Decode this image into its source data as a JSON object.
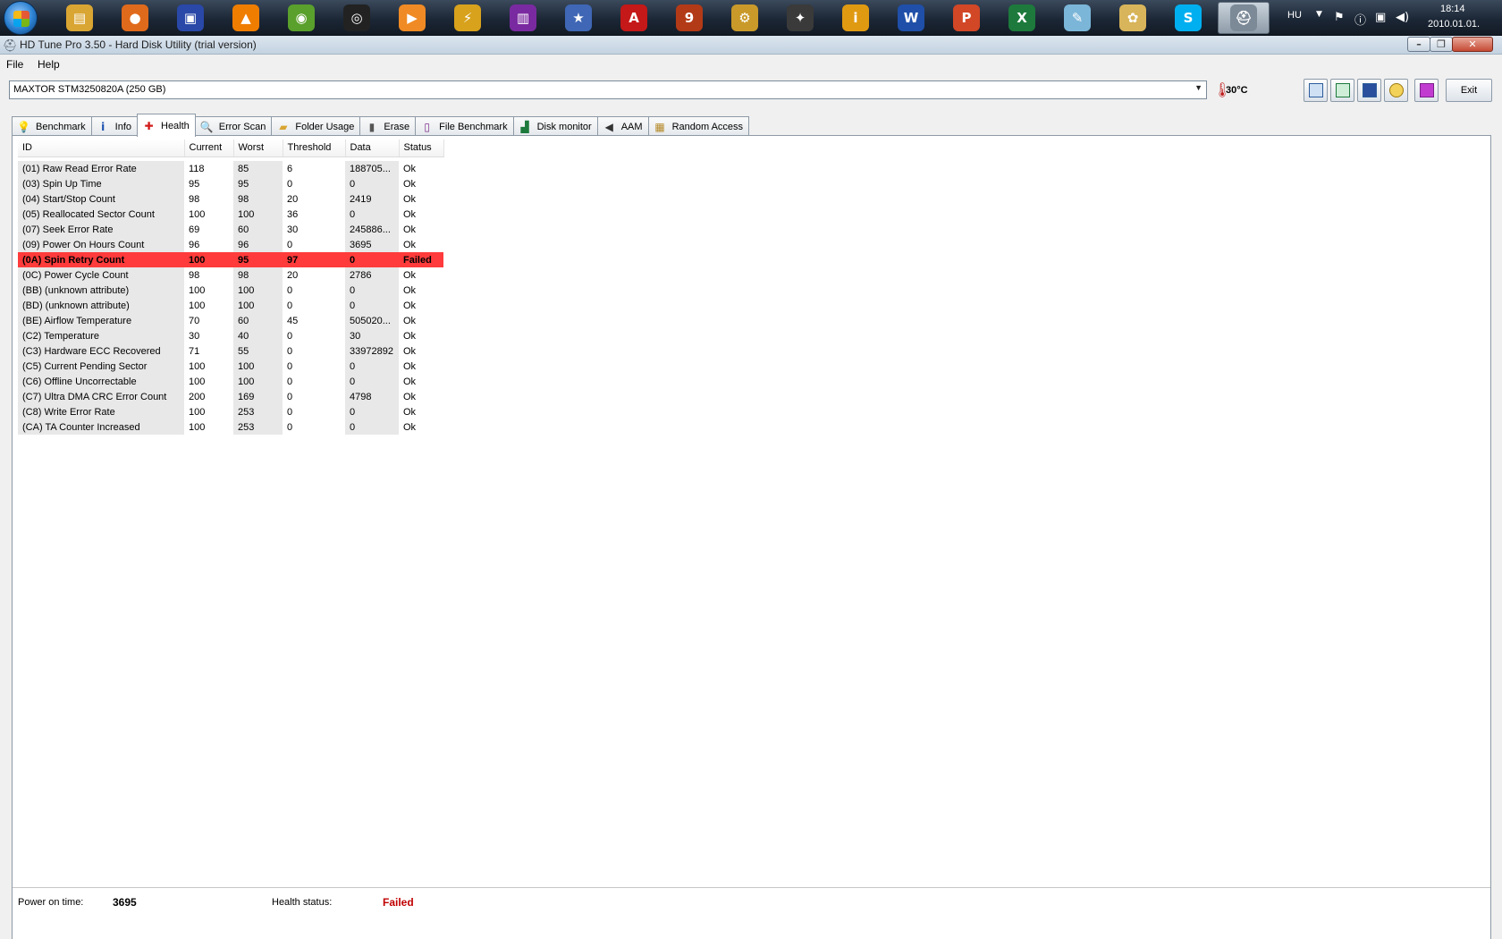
{
  "taskbar": {
    "apps": [
      {
        "name": "windows-explorer-icon",
        "glyph": "▤",
        "color": "#d9a533"
      },
      {
        "name": "firefox-icon",
        "glyph": "●",
        "color": "#e06a1b"
      },
      {
        "name": "save-floppy-icon",
        "glyph": "▣",
        "color": "#2948a8"
      },
      {
        "name": "vlc-icon",
        "glyph": "▲",
        "color": "#ef7d00"
      },
      {
        "name": "windows-media-icon",
        "glyph": "◉",
        "color": "#5aa02c"
      },
      {
        "name": "eye-app-icon",
        "glyph": "◎",
        "color": "#222222"
      },
      {
        "name": "media-player-icon",
        "glyph": "▶",
        "color": "#f08a24"
      },
      {
        "name": "winamp-icon",
        "glyph": "⚡",
        "color": "#d8a21c"
      },
      {
        "name": "winrar-icon",
        "glyph": "▥",
        "color": "#7a2aa0"
      },
      {
        "name": "shield-app-icon",
        "glyph": "★",
        "color": "#3f67b5"
      },
      {
        "name": "adobe-reader-icon",
        "glyph": "A",
        "color": "#c51818"
      },
      {
        "name": "nero-icon",
        "glyph": "9",
        "color": "#b33a17"
      },
      {
        "name": "gear-app-icon",
        "glyph": "⚙",
        "color": "#c99a2a"
      },
      {
        "name": "settings-app-icon",
        "glyph": "✦",
        "color": "#3a3a3a"
      },
      {
        "name": "info-app-icon",
        "glyph": "i",
        "color": "#e09a12"
      },
      {
        "name": "word-icon",
        "glyph": "W",
        "color": "#1f4fa8"
      },
      {
        "name": "powerpoint-icon",
        "glyph": "P",
        "color": "#d24726"
      },
      {
        "name": "excel-icon",
        "glyph": "X",
        "color": "#1d7a3c"
      },
      {
        "name": "notepad-icon",
        "glyph": "✎",
        "color": "#7bb6d8"
      },
      {
        "name": "paint-icon",
        "glyph": "✿",
        "color": "#d8b45a"
      },
      {
        "name": "skype-icon",
        "glyph": "S",
        "color": "#00aff0"
      },
      {
        "name": "hd-tune-icon",
        "glyph": "⛑",
        "color": "#7c8a98"
      }
    ],
    "language": "HU",
    "time": "18:14",
    "date": "2010.01.01."
  },
  "window": {
    "title": "HD Tune Pro 3.50 - Hard Disk Utility (trial version)"
  },
  "menu": {
    "file": "File",
    "help": "Help"
  },
  "toolbar": {
    "drive": "MAXTOR STM3250820A (250 GB)",
    "temperature": "30°C",
    "exit": "Exit"
  },
  "tabs": [
    {
      "label": "Benchmark",
      "icon": "benchmark-icon",
      "glyph": "💡",
      "color": "#c8a400"
    },
    {
      "label": "Info",
      "icon": "info-icon",
      "glyph": "i",
      "color": "#1a4fb0"
    },
    {
      "label": "Health",
      "icon": "health-cross-icon",
      "glyph": "✚",
      "color": "#d21a1a"
    },
    {
      "label": "Error Scan",
      "icon": "magnifier-icon",
      "glyph": "🔍",
      "color": "#2a5da8"
    },
    {
      "label": "Folder Usage",
      "icon": "folder-icon",
      "glyph": "▰",
      "color": "#d9a533"
    },
    {
      "label": "Erase",
      "icon": "trash-icon",
      "glyph": "▮",
      "color": "#555555"
    },
    {
      "label": "File Benchmark",
      "icon": "file-benchmark-icon",
      "glyph": "▯",
      "color": "#7a2a8a"
    },
    {
      "label": "Disk monitor",
      "icon": "chart-icon",
      "glyph": "▟",
      "color": "#1d7a3c"
    },
    {
      "label": "AAM",
      "icon": "speaker-icon",
      "glyph": "◀",
      "color": "#333333"
    },
    {
      "label": "Random Access",
      "icon": "random-access-icon",
      "glyph": "▦",
      "color": "#b58a2a"
    }
  ],
  "smart": {
    "columns": {
      "id": "ID",
      "current": "Current",
      "worst": "Worst",
      "threshold": "Threshold",
      "data": "Data",
      "status": "Status"
    },
    "rows": [
      {
        "id": "(01) Raw Read Error Rate",
        "current": "118",
        "worst": "85",
        "threshold": "6",
        "data": "188705...",
        "status": "Ok"
      },
      {
        "id": "(03) Spin Up Time",
        "current": "95",
        "worst": "95",
        "threshold": "0",
        "data": "0",
        "status": "Ok"
      },
      {
        "id": "(04) Start/Stop Count",
        "current": "98",
        "worst": "98",
        "threshold": "20",
        "data": "2419",
        "status": "Ok"
      },
      {
        "id": "(05) Reallocated Sector Count",
        "current": "100",
        "worst": "100",
        "threshold": "36",
        "data": "0",
        "status": "Ok"
      },
      {
        "id": "(07) Seek Error Rate",
        "current": "69",
        "worst": "60",
        "threshold": "30",
        "data": "245886...",
        "status": "Ok"
      },
      {
        "id": "(09) Power On Hours Count",
        "current": "96",
        "worst": "96",
        "threshold": "0",
        "data": "3695",
        "status": "Ok"
      },
      {
        "id": "(0A) Spin Retry Count",
        "current": "100",
        "worst": "95",
        "threshold": "97",
        "data": "0",
        "status": "Failed",
        "failed": true
      },
      {
        "id": "(0C) Power Cycle Count",
        "current": "98",
        "worst": "98",
        "threshold": "20",
        "data": "2786",
        "status": "Ok"
      },
      {
        "id": "(BB) (unknown attribute)",
        "current": "100",
        "worst": "100",
        "threshold": "0",
        "data": "0",
        "status": "Ok"
      },
      {
        "id": "(BD) (unknown attribute)",
        "current": "100",
        "worst": "100",
        "threshold": "0",
        "data": "0",
        "status": "Ok"
      },
      {
        "id": "(BE) Airflow Temperature",
        "current": "70",
        "worst": "60",
        "threshold": "45",
        "data": "505020...",
        "status": "Ok"
      },
      {
        "id": "(C2) Temperature",
        "current": "30",
        "worst": "40",
        "threshold": "0",
        "data": "30",
        "status": "Ok"
      },
      {
        "id": "(C3) Hardware ECC Recovered",
        "current": "71",
        "worst": "55",
        "threshold": "0",
        "data": "33972892",
        "status": "Ok"
      },
      {
        "id": "(C5) Current Pending Sector",
        "current": "100",
        "worst": "100",
        "threshold": "0",
        "data": "0",
        "status": "Ok"
      },
      {
        "id": "(C6) Offline Uncorrectable",
        "current": "100",
        "worst": "100",
        "threshold": "0",
        "data": "0",
        "status": "Ok"
      },
      {
        "id": "(C7) Ultra DMA CRC Error Count",
        "current": "200",
        "worst": "169",
        "threshold": "0",
        "data": "4798",
        "status": "Ok"
      },
      {
        "id": "(C8) Write Error Rate",
        "current": "100",
        "worst": "253",
        "threshold": "0",
        "data": "0",
        "status": "Ok"
      },
      {
        "id": "(CA) TA Counter Increased",
        "current": "100",
        "worst": "253",
        "threshold": "0",
        "data": "0",
        "status": "Ok"
      }
    ]
  },
  "footer": {
    "power_on_label": "Power on time:",
    "power_on_value": "3695",
    "health_label": "Health status:",
    "health_value": "Failed",
    "health_color": "#c00000"
  }
}
